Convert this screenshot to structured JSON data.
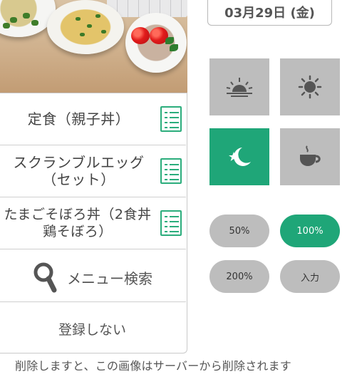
{
  "date": "03月29日 (金)",
  "menu_items": [
    {
      "label": "定食（親子丼）"
    },
    {
      "label": "スクランブルエッグ\n（セット）"
    },
    {
      "label": "たまごそぼろ丼（2食丼\n鶏そぼろ）"
    }
  ],
  "search_label": "メニュー検索",
  "skip_label": "登録しない",
  "notice": "削除しますと、この画像はサーバーから削除されます",
  "meal_tiles": [
    {
      "icon": "sunrise-icon",
      "active": false
    },
    {
      "icon": "sun-icon",
      "active": false
    },
    {
      "icon": "moon-star-icon",
      "active": true
    },
    {
      "icon": "tea-cup-icon",
      "active": false
    }
  ],
  "portion_buttons": [
    {
      "label": "50%",
      "active": false
    },
    {
      "label": "100%",
      "active": true
    },
    {
      "label": "200%",
      "active": false
    },
    {
      "label": "入力",
      "active": false
    }
  ],
  "colors": {
    "accent": "#1fa678",
    "tile": "#bdbdbd",
    "text": "#444444"
  }
}
